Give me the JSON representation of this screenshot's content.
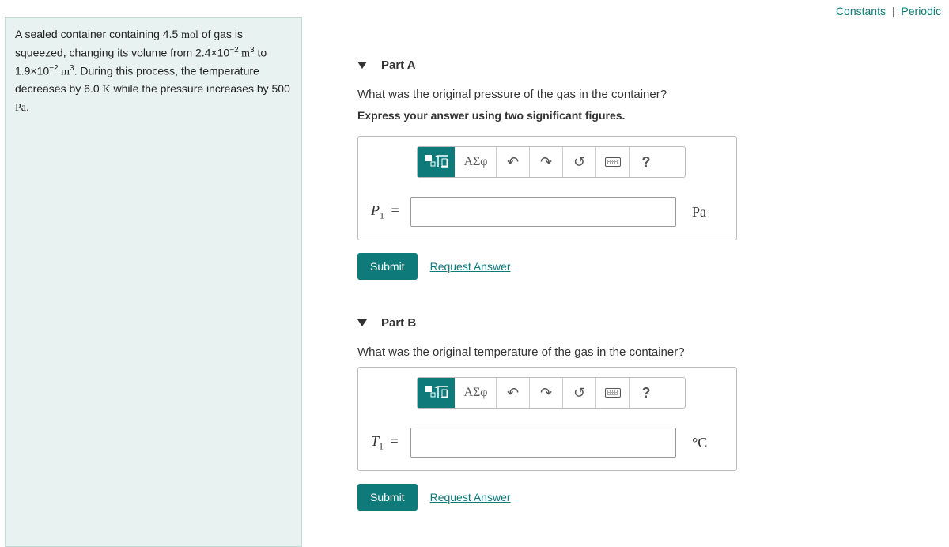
{
  "topLinks": {
    "constants": "Constants",
    "periodic": "Periodic"
  },
  "problem": {
    "line1a": "A sealed container containing 4.5 ",
    "mol": "mol",
    "line1b": " of gas is squeezed, changing its volume from 2.4×10",
    "exp1": "−2",
    "m3a": " m",
    "cube": "3",
    "line2a": " to 1.9×10",
    "exp2": "−2",
    "m3b": " m",
    "line2b": ". During this process, the temperature decreases by 6.0 ",
    "K": "K",
    "line2c": " while the pressure increases by 500 ",
    "Pa": "Pa",
    "line2d": "."
  },
  "partA": {
    "title": "Part A",
    "question": "What was the original pressure of the gas in the container?",
    "instruction": "Express your answer using two significant figures.",
    "toolbar": {
      "symbols": "ΑΣφ",
      "undo": "↶",
      "redo": "↷",
      "reset": "↺",
      "help": "?"
    },
    "varLabel": "P",
    "varSub": "1",
    "eq": " = ",
    "unit": "Pa",
    "submit": "Submit",
    "request": "Request Answer"
  },
  "partB": {
    "title": "Part B",
    "question": "What was the original temperature of the gas in the container?",
    "toolbar": {
      "symbols": "ΑΣφ",
      "undo": "↶",
      "redo": "↷",
      "reset": "↺",
      "help": "?"
    },
    "varLabel": "T",
    "varSub": "1",
    "eq": " = ",
    "unit": "°C",
    "submit": "Submit",
    "request": "Request Answer"
  }
}
